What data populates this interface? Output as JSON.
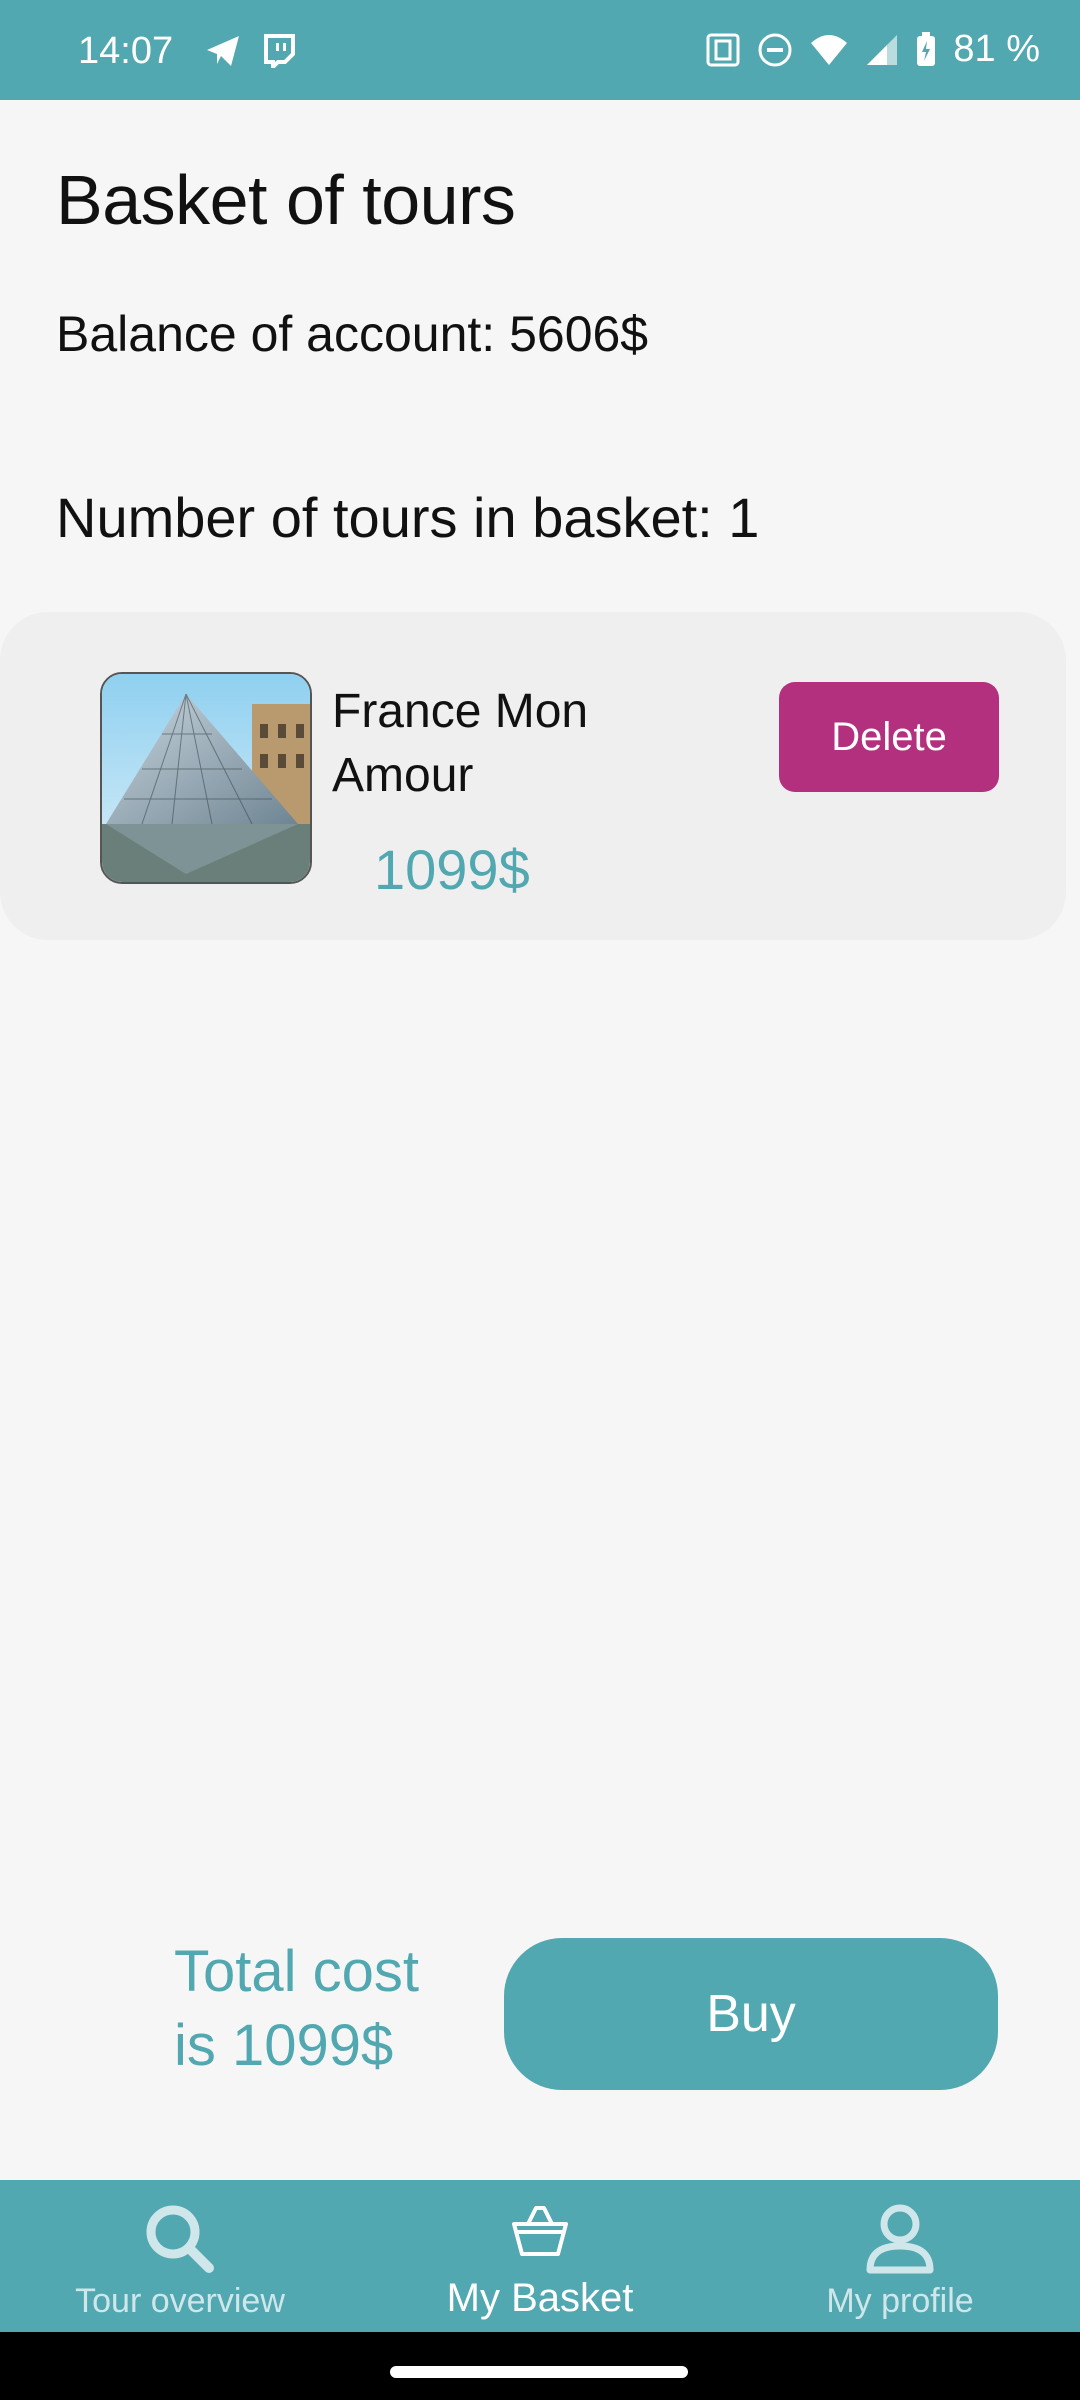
{
  "status_bar": {
    "time": "14:07",
    "battery": "81 %",
    "icons": [
      "telegram-icon",
      "twitch-icon",
      "nfc-icon",
      "do-not-disturb-icon",
      "wifi-icon",
      "signal-icon",
      "battery-icon"
    ]
  },
  "page": {
    "title": "Basket of tours",
    "balance": "Balance of account: 5606$",
    "tours_count": "Number of tours in basket: 1"
  },
  "basket_items": [
    {
      "name": "France Mon Amour",
      "price": "1099$",
      "delete_label": "Delete",
      "image": "louvre-pyramid-photo"
    }
  ],
  "checkout": {
    "total": "Total cost is 1099$",
    "buy_label": "Buy"
  },
  "bottom_nav": {
    "items": [
      {
        "label": "Tour overview",
        "icon": "search-icon",
        "active": false
      },
      {
        "label": "My Basket",
        "icon": "basket-icon",
        "active": true
      },
      {
        "label": "My profile",
        "icon": "person-icon",
        "active": false
      }
    ]
  },
  "colors": {
    "primary": "#52a8b0",
    "delete": "#b3307f",
    "background": "#f6f6f6",
    "card": "#efefef"
  }
}
